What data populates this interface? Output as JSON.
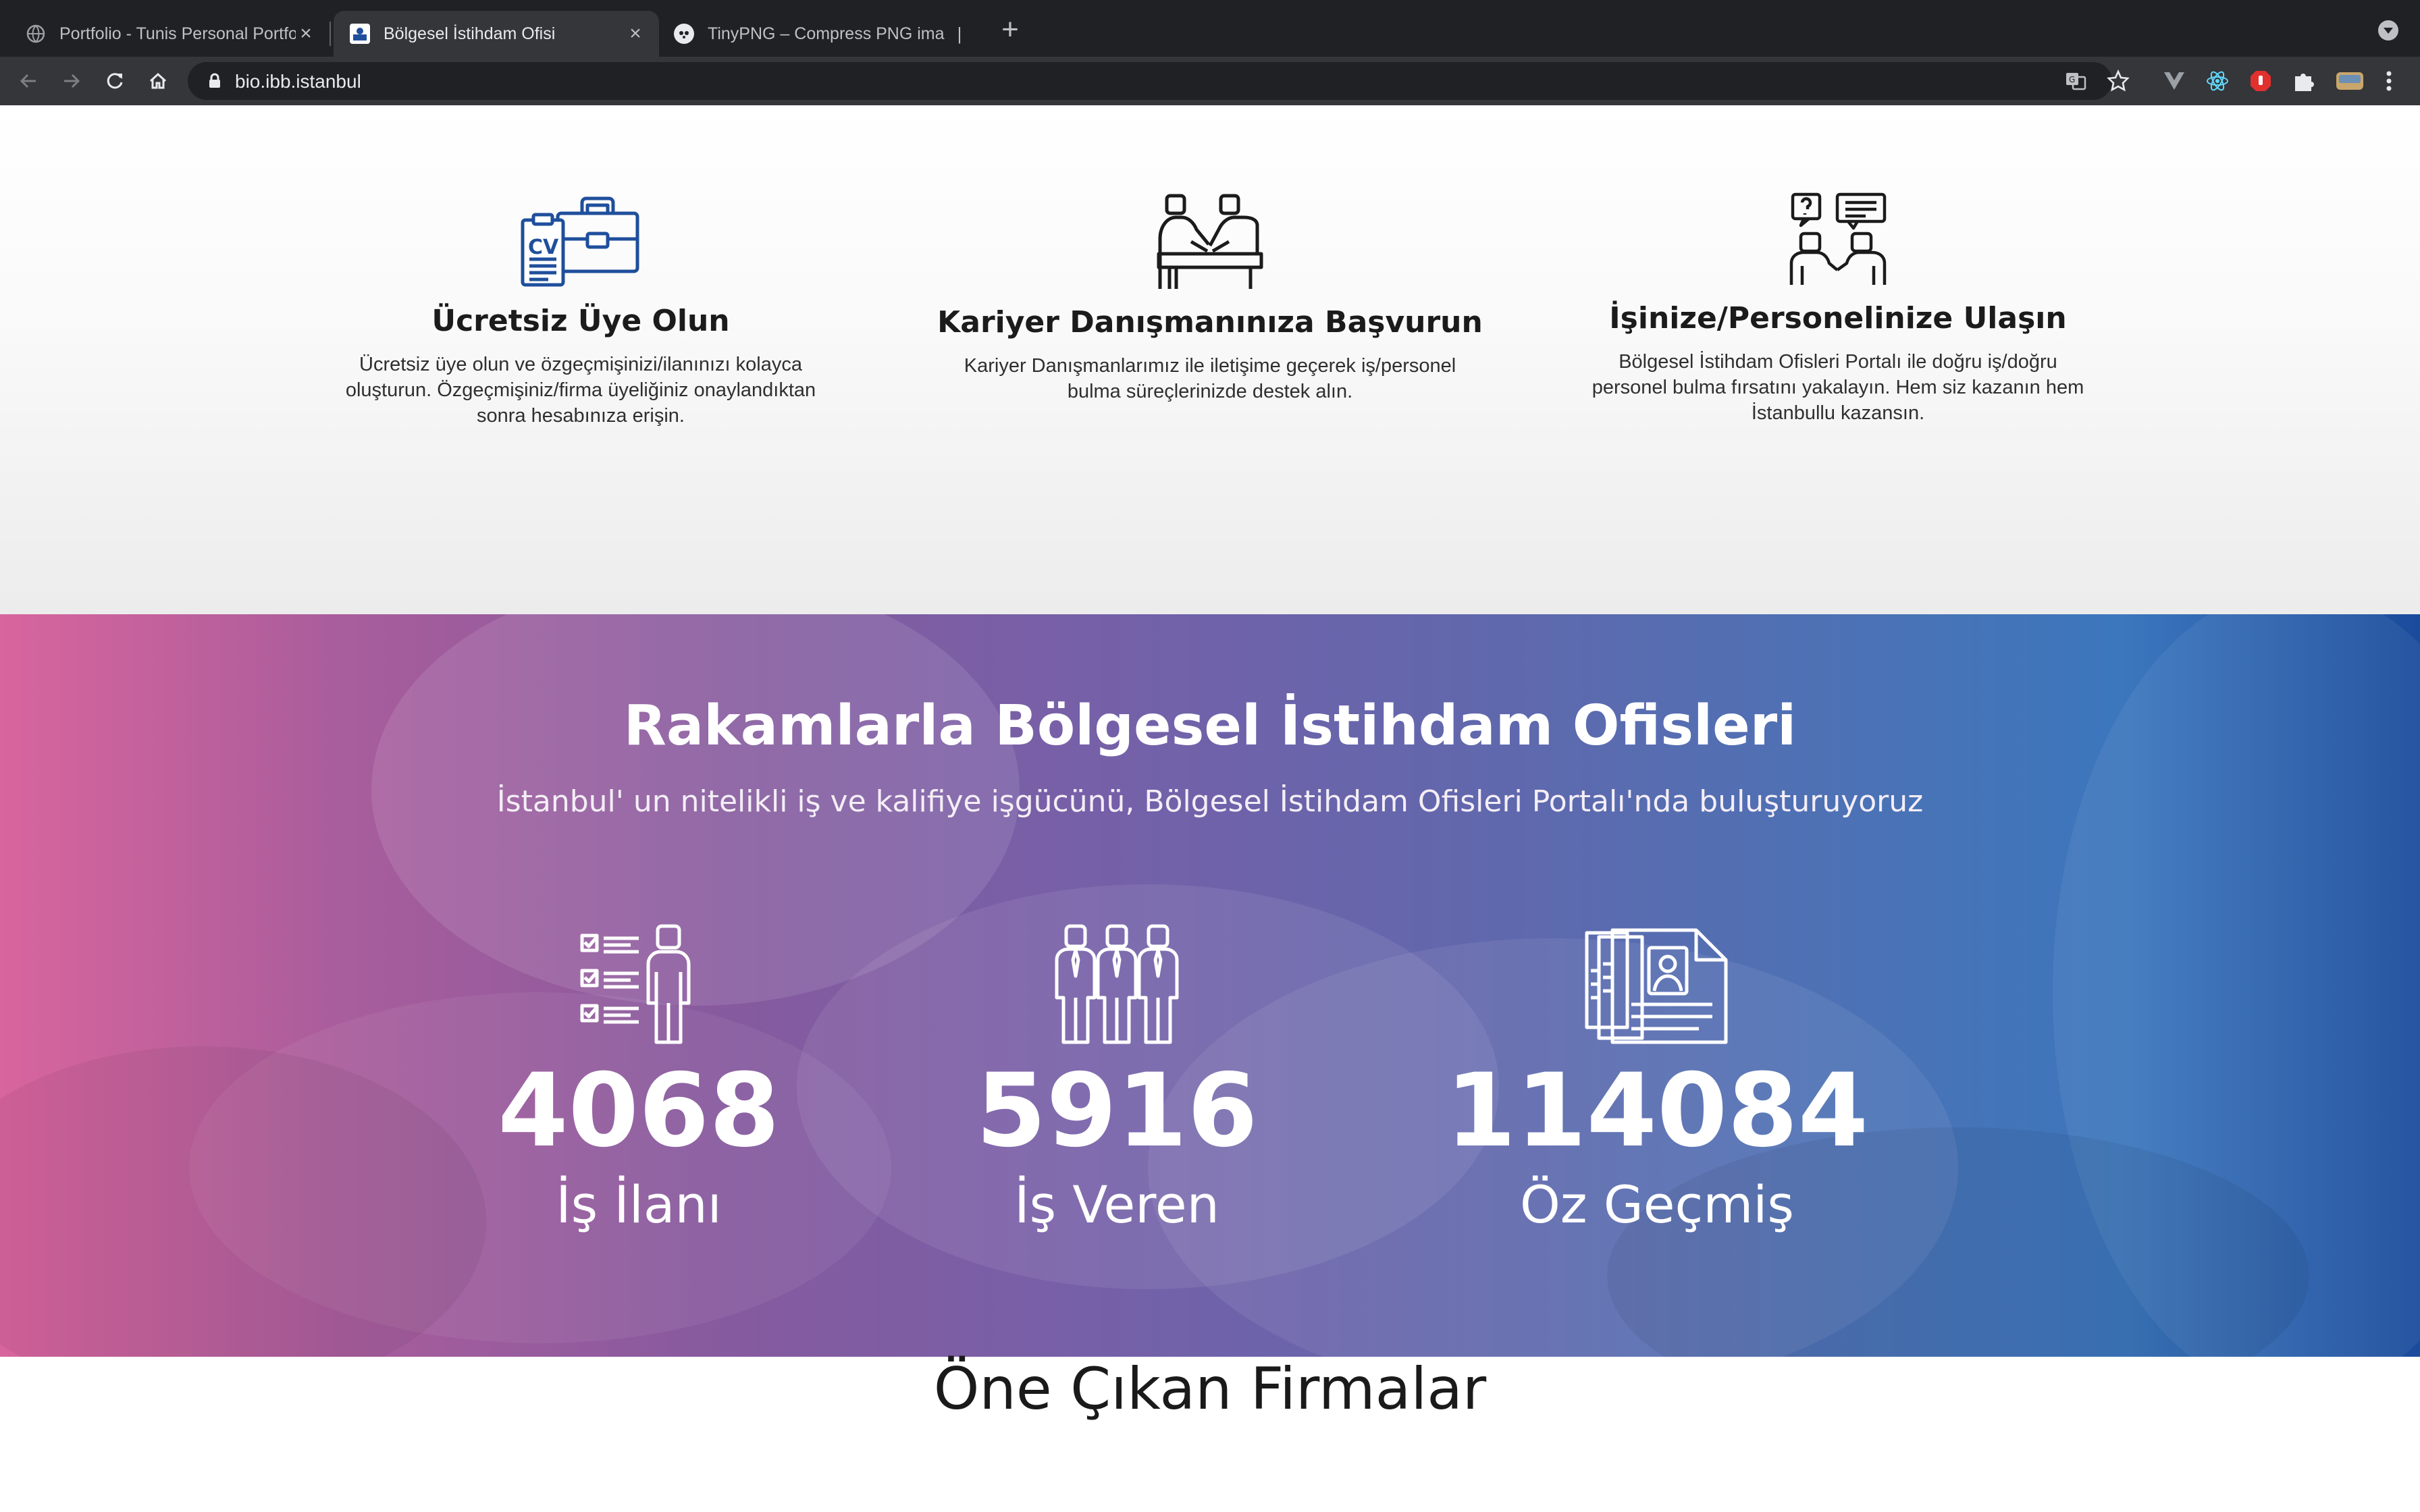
{
  "browser": {
    "tabs": [
      {
        "title": "Portfolio - Tunis Personal Portfo",
        "active": false
      },
      {
        "title": "Bölgesel İstihdam Ofisi",
        "active": true
      },
      {
        "title": "TinyPNG – Compress PNG ima",
        "active": false
      }
    ],
    "new_tab_symbol": "+",
    "url": "bio.ibb.istanbul",
    "extension_icons": [
      "translate-icon",
      "star-icon",
      "vue-devtools-icon",
      "react-devtools-icon",
      "adblock-icon",
      "puzzle-extensions-icon",
      "profile-avatar",
      "menu-icon"
    ]
  },
  "features": [
    {
      "icon": "cv-briefcase-icon",
      "title": "Ücretsiz Üye Olun",
      "line1": "Ücretsiz üye olun ve özgeçmişinizi/ilanınızı kolayca",
      "line2": "oluşturun. Özgeçmişiniz/firma üyeliğiniz onaylandıktan",
      "line3": "sonra hesabınıza erişin."
    },
    {
      "icon": "consultation-desk-icon",
      "title": "Kariyer Danışmanınıza Başvurun",
      "line1": "Kariyer Danışmanlarımız ile iletişime geçerek iş/personel",
      "line2": "bulma süreçlerinizde destek alın."
    },
    {
      "icon": "people-chat-icon",
      "title": "İşinize/Personelinize Ulaşın",
      "line1": "Bölgesel İstihdam Ofisleri Portalı ile doğru iş/doğru",
      "line2": "personel bulma fırsatını yakalayın. Hem siz kazanın hem",
      "line3": "İstanbullu kazansın."
    }
  ],
  "stats_section": {
    "title": "Rakamlarla Bölgesel İstihdam Ofisleri",
    "subtitle": "İstanbul' un nitelikli iş ve kalifiye işgücünü, Bölgesel İstihdam Ofisleri Portalı'nda buluşturuyoruz",
    "items": [
      {
        "icon": "checklist-person-icon",
        "value": "4068",
        "label": "İş İlanı"
      },
      {
        "icon": "three-employers-icon",
        "value": "5916",
        "label": "İş Veren"
      },
      {
        "icon": "resume-documents-icon",
        "value": "114084",
        "label": "Öz Geçmiş"
      }
    ]
  },
  "featured": {
    "title": "Öne Çıkan Firmalar"
  },
  "colors": {
    "chrome_dark": "#202124",
    "chrome_toolbar": "#35363a",
    "gradient_left": "#d8659d",
    "gradient_mid": "#7660a8",
    "gradient_right": "#1a4b9c",
    "cv_icon_blue": "#1f4f9c"
  }
}
